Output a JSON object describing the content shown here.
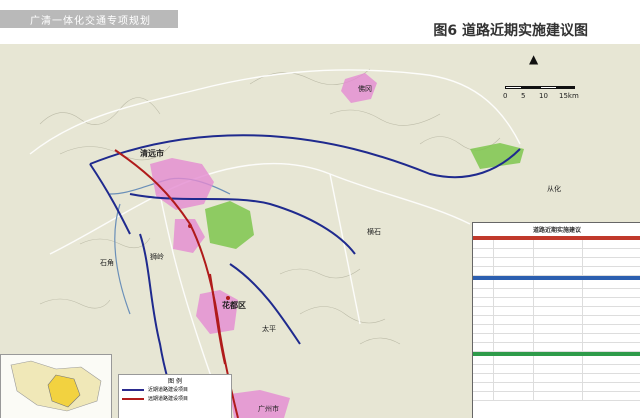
{
  "header": {
    "ribbon_text": "广清一体化交通专项规划",
    "figure_title": "图6   道路近期实施建议图"
  },
  "scale": {
    "ticks": [
      "0",
      "5",
      "10",
      "15km"
    ]
  },
  "places": {
    "qingyuan": "清远市",
    "fogang": "佛冈",
    "yingde_region": "横石",
    "shijiao": "石角",
    "huadu": "花都区",
    "guangzhou": "广州市",
    "conghua": "从化",
    "shiling": "狮岭",
    "taiping": "太平"
  },
  "legend": {
    "title": "图  例",
    "items": [
      {
        "label": "近期道路建设项目",
        "color": "#2b2b8f"
      },
      {
        "label": "远期道路建设项目",
        "color": "#b01b1b"
      }
    ]
  },
  "table": {
    "title": "道路近期实施建议"
  },
  "colors": {
    "map_bg": "#e6e6d2",
    "relief": "#9a9a8a",
    "urban_pink": "#e58bd2",
    "green": "#7ec64e",
    "road_blue": "#1f2a8e",
    "road_red": "#b01b1b",
    "water": "#6a8fb8"
  }
}
